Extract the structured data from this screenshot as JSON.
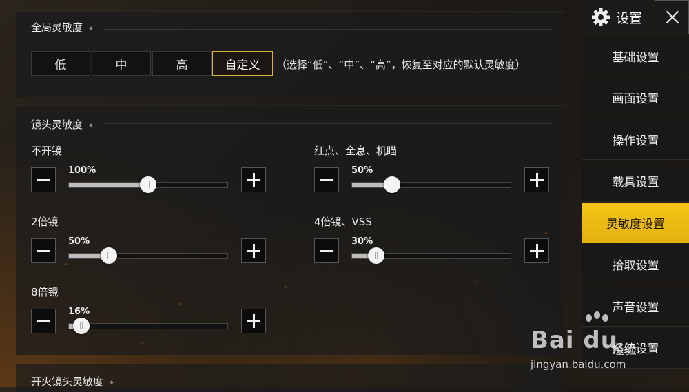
{
  "global": {
    "title": "全局灵敏度",
    "options": [
      "低",
      "中",
      "高",
      "自定义"
    ],
    "selected": "自定义",
    "hint": "（选择“低”、“中”、“高”，恢复至对应的默认灵敏度）"
  },
  "lens": {
    "title": "镜头灵敏度",
    "sliders": [
      {
        "label": "不开镜",
        "value": 100,
        "display": "100%"
      },
      {
        "label": "红点、全息、机瞄",
        "value": 50,
        "display": "50%"
      },
      {
        "label": "2倍镜",
        "value": 50,
        "display": "50%"
      },
      {
        "label": "4倍镜、VSS",
        "value": 30,
        "display": "30%"
      },
      {
        "label": "8倍镜",
        "value": 16,
        "display": "16%"
      }
    ]
  },
  "fire": {
    "title": "开火镜头灵敏度"
  },
  "sidebar": {
    "title": "设置",
    "icon": "gear-icon",
    "close_icon": "close-icon",
    "items": [
      "基础设置",
      "画面设置",
      "操作设置",
      "载具设置",
      "灵敏度设置",
      "拾取设置",
      "声音设置",
      "系统设置"
    ],
    "active": "灵敏度设置"
  },
  "watermark": {
    "logo": "Bai du",
    "cn": "经验",
    "url": "jingyan.baidu.com"
  },
  "colors": {
    "accent": "#f5c517",
    "selected_border": "#d7b24a"
  }
}
